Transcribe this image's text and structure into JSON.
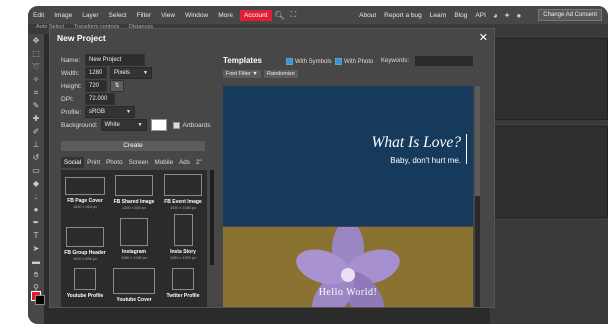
{
  "menubar": {
    "items": [
      "Edit",
      "Image",
      "Layer",
      "Select",
      "Filter",
      "View",
      "Window",
      "More"
    ],
    "account": "Account",
    "right_links": [
      "About",
      "Report a bug",
      "Learn",
      "Blog",
      "API"
    ],
    "consent_button": "Change Ad Consent",
    "accent": "#e01e37"
  },
  "options_bar": {
    "auto_select": "Auto Select",
    "transform": "Transform controls",
    "distances": "Distances"
  },
  "dialog": {
    "title": "New Project",
    "close": "✕",
    "name_label": "Name:",
    "name_value": "New Project",
    "width_label": "Width:",
    "width_value": "1280",
    "unit_value": "Pixels",
    "height_label": "Height:",
    "height_value": "720",
    "swap_icon": "⇅",
    "dpi_label": "DPI:",
    "dpi_value": "72.000",
    "profile_label": "Profile:",
    "profile_value": "sRGB",
    "background_label": "Background:",
    "background_value": "White",
    "background_color": "#ffffff",
    "artboards_label": "Artboards",
    "create_label": "Create",
    "tabs": [
      "Social",
      "Print",
      "Photo",
      "Screen",
      "Mobile",
      "Ads",
      "2\""
    ],
    "presets": [
      {
        "name": "FB Page Cover",
        "size": "1640 x 664 px"
      },
      {
        "name": "FB Shared Image",
        "size": "1200 x 630 px"
      },
      {
        "name": "FB Event Image",
        "size": "1920 x 1080 px"
      },
      {
        "name": "FB Group Header",
        "size": "1640 x 856 px"
      },
      {
        "name": "Instagram",
        "size": "1080 x 1080 px"
      },
      {
        "name": "Insta Story",
        "size": "1080 x 1920 px"
      },
      {
        "name": "Youtube Profile",
        "size": ""
      },
      {
        "name": "Youtube Cover",
        "size": ""
      },
      {
        "name": "Twitter Profile",
        "size": ""
      }
    ]
  },
  "templates": {
    "title": "Templates",
    "with_symbols": "With Symbols",
    "with_photo": "With Photo",
    "keywords_label": "Keywords:",
    "font_filter": "Font Filter ▼",
    "randomize": "Randomize",
    "card1": {
      "headline": "What Is Love?",
      "sub": "Baby, don't hurt me.",
      "bg": "#163a5c"
    },
    "card2": {
      "headline": "Hello World!",
      "bg": "#8a7330"
    }
  }
}
